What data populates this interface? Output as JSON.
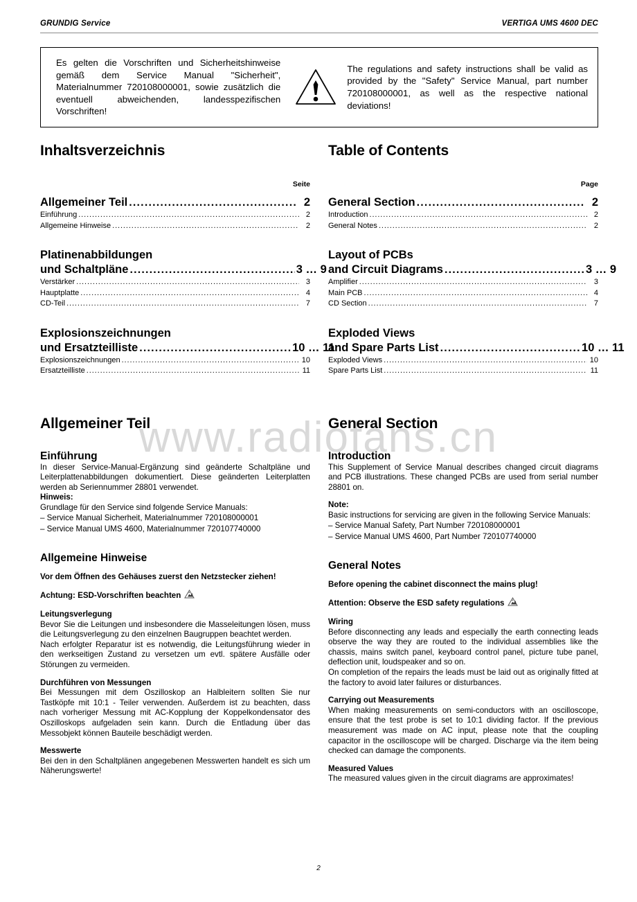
{
  "header": {
    "left": "GRUNDIG Service",
    "right": "VERTIGA UMS 4600 DEC"
  },
  "safety_box": {
    "icon": "warning-triangle-icon",
    "german": "Es gelten die Vorschriften und Sicherheitshinweise gemäß dem Service Manual \"Sicherheit\", Materialnummer 720108000001, sowie zusätzlich die eventuell abweichenden, landesspezifischen Vorschriften!",
    "english": "The regulations and safety instructions shall be valid as provided by the \"Safety\" Service Manual, part number 720108000001, as well as the respective national deviations!"
  },
  "watermark": "www.radiofans.cn",
  "toc_de": {
    "title": "Inhaltsverzeichnis",
    "page_column": "Seite",
    "groups": [
      {
        "main_lines": [
          "Allgemeiner Teil"
        ],
        "main_page": "2",
        "items": [
          {
            "label": "Einführung",
            "page": "2"
          },
          {
            "label": "Allgemeine Hinweise",
            "page": "2"
          }
        ]
      },
      {
        "main_lines": [
          "Platinenabbildungen",
          "und Schaltpläne"
        ],
        "main_page": "3 … 9",
        "items": [
          {
            "label": "Verstärker",
            "page": "3"
          },
          {
            "label": "Hauptplatte",
            "page": "4"
          },
          {
            "label": "CD-Teil",
            "page": "7"
          }
        ]
      },
      {
        "main_lines": [
          "Explosionszeichnungen",
          "und Ersatzteilliste"
        ],
        "main_page": "10 … 11",
        "items": [
          {
            "label": "Explosionszeichnungen",
            "page": "10"
          },
          {
            "label": "Ersatzteilliste",
            "page": "11"
          }
        ]
      }
    ]
  },
  "toc_en": {
    "title": "Table of Contents",
    "page_column": "Page",
    "groups": [
      {
        "main_lines": [
          "General Section"
        ],
        "main_page": "2",
        "items": [
          {
            "label": "Introduction",
            "page": "2"
          },
          {
            "label": "General Notes",
            "page": "2"
          }
        ]
      },
      {
        "main_lines": [
          "Layout of PCBs",
          "and Circuit Diagrams"
        ],
        "main_page": "3 … 9",
        "items": [
          {
            "label": "Amplifier",
            "page": "3"
          },
          {
            "label": "Main PCB",
            "page": "4"
          },
          {
            "label": "CD Section",
            "page": "7"
          }
        ]
      },
      {
        "main_lines": [
          "Exploded Views",
          "and Spare Parts List"
        ],
        "main_page": "10 … 11",
        "items": [
          {
            "label": "Exploded Views",
            "page": "10"
          },
          {
            "label": "Spare Parts List",
            "page": "11"
          }
        ]
      }
    ]
  },
  "body_de": {
    "section_title": "Allgemeiner Teil",
    "intro": {
      "heading": "Einführung",
      "p1": "In dieser Service-Manual-Ergänzung sind geänderte Schaltpläne und Leiterplattenabbildungen dokumentiert. Diese geänderten Leiterplatten werden ab Seriennummer 28801 verwendet.",
      "note_label": "Hinweis:",
      "note_text": "Grundlage für den Service sind folgende Service Manuals:",
      "manuals": [
        "–  Service Manual Sicherheit, Materialnummer 720108000001",
        "–  Service Manual UMS 4600, Materialnummer 720107740000"
      ]
    },
    "notes": {
      "heading": "Allgemeine Hinweise",
      "warn1": "Vor dem Öffnen des Gehäuses zuerst den Netzstecker ziehen!",
      "warn2": "Achtung: ESD-Vorschriften beachten",
      "wiring_label": "Leitungsverlegung",
      "wiring_p1": "Bevor Sie die Leitungen und insbesondere die Masseleitungen lösen, muss die Leitungsverlegung zu den einzelnen Baugruppen beachtet werden.",
      "wiring_p2": "Nach erfolgter Reparatur ist es notwendig, die Leitungsführung wieder in den werkseitigen Zustand zu versetzen um evtl. spätere Ausfälle oder Störungen zu vermeiden.",
      "meas_label": "Durchführen von Messungen",
      "meas_p1": "Bei Messungen mit dem Oszilloskop an Halbleitern sollten Sie nur Tastköpfe mit 10:1 - Teiler verwenden. Außerdem ist zu beachten, dass nach vorheriger Messung mit AC-Kopplung der Koppelkondensator des Oszilloskops aufgeladen sein kann. Durch die Entladung über das Messobjekt können Bauteile beschädigt werden.",
      "values_label": "Messwerte",
      "values_p1": "Bei den in den Schaltplänen angegebenen Messwerten handelt es sich um Näherungswerte!"
    }
  },
  "body_en": {
    "section_title": "General Section",
    "intro": {
      "heading": "Introduction",
      "p1": "This Supplement of Service Manual describes changed circuit diagrams and PCB illustrations. These changed PCBs are used from serial number 28801 on.",
      "note_label": "Note:",
      "note_text": "Basic instructions for servicing are given in the following Service Manuals:",
      "manuals": [
        "–  Service Manual Safety, Part Number 720108000001",
        "–  Service Manual UMS 4600, Part Number 720107740000"
      ]
    },
    "notes": {
      "heading": "General Notes",
      "warn1": "Before opening the cabinet disconnect the mains plug!",
      "warn2": "Attention: Observe the ESD safety regulations",
      "wiring_label": "Wiring",
      "wiring_p1": "Before disconnecting any leads and especially the earth connecting leads observe the way they are routed to the individual assemblies like the chassis, mains switch panel, keyboard control panel, picture tube panel, deflection unit, loudspeaker and so on.",
      "wiring_p2": "On completion of the repairs the leads must be laid out as originally fitted at the factory to avoid later failures or disturbances.",
      "meas_label": "Carrying out Measurements",
      "meas_p1": "When making measurements on semi-conductors with an oscilloscope, ensure that the test probe is set to 10:1 dividing factor. If the previous measurement was made on AC input, please note that the coupling capacitor in the oscilloscope will be charged. Discharge via the item being checked can damage the components.",
      "values_label": "Measured Values",
      "values_p1": "The measured values given in the circuit diagrams are approximates!"
    }
  },
  "footer": {
    "page_number": "2"
  }
}
